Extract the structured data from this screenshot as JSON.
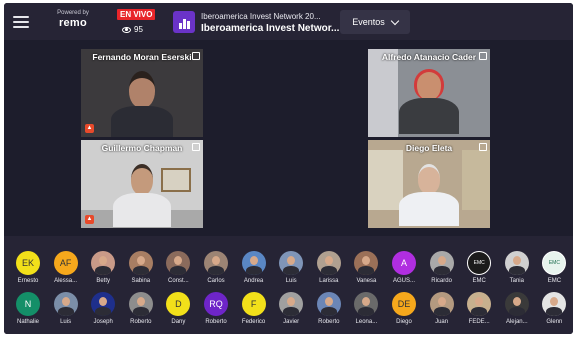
{
  "topbar": {
    "powered_by": "Powered by",
    "logo": "remo",
    "live": "EN VIVO",
    "viewers": "95",
    "event_title_1": "Iberoamerica Invest Network 20...",
    "event_title_2": "Iberoamerica Invest Networ...",
    "eventos": "Eventos"
  },
  "tiles": [
    {
      "name": "Fernando Moran Eserski"
    },
    {
      "name": "Alfredo Atanacio Cader"
    },
    {
      "name": "Guillermo Chapman"
    },
    {
      "name": "Diego Eleta"
    }
  ],
  "attendees_row1": [
    {
      "label": "Ernesto",
      "initials": "EK",
      "color": "#f2e01a"
    },
    {
      "label": "Alessa...",
      "initials": "AF",
      "color": "#f6a81c"
    },
    {
      "label": "Betty",
      "initials": "",
      "color": "#c99a88"
    },
    {
      "label": "Sabina",
      "initials": "",
      "color": "#a87e63"
    },
    {
      "label": "Const...",
      "initials": "",
      "color": "#8b6b5c"
    },
    {
      "label": "Carlos",
      "initials": "",
      "color": "#9c8474"
    },
    {
      "label": "Andrea",
      "initials": "",
      "color": "#5a87c4"
    },
    {
      "label": "Luis",
      "initials": "",
      "color": "#7f95b8"
    },
    {
      "label": "Larissa",
      "initials": "",
      "color": "#b0a090"
    },
    {
      "label": "Vanesa",
      "initials": "",
      "color": "#9b7058"
    },
    {
      "label": "AGUS...",
      "initials": "A",
      "color": "#b02ee0"
    },
    {
      "label": "Ricardo",
      "initials": "",
      "color": "#a9a9a9"
    },
    {
      "label": "EMC",
      "initials": "EMC",
      "color": "#1b1b1b"
    },
    {
      "label": "Tania",
      "initials": "",
      "color": "#d0d0d0"
    },
    {
      "label": "EMC",
      "initials": "EMC",
      "color": "#e8f4ee"
    }
  ],
  "attendees_row2": [
    {
      "label": "Nathalie",
      "initials": "N",
      "color": "#148f68"
    },
    {
      "label": "Luis",
      "initials": "",
      "color": "#7b8ea8"
    },
    {
      "label": "Joseph",
      "initials": "",
      "color": "#1e2f8c"
    },
    {
      "label": "Roberto",
      "initials": "",
      "color": "#8d8d8d"
    },
    {
      "label": "Dany",
      "initials": "D",
      "color": "#f2e01a"
    },
    {
      "label": "Roberto",
      "initials": "RQ",
      "color": "#6e25c8"
    },
    {
      "label": "Federico",
      "initials": "F",
      "color": "#f2e01a"
    },
    {
      "label": "Javier",
      "initials": "",
      "color": "#a0a0a0"
    },
    {
      "label": "Roberto",
      "initials": "",
      "color": "#6b86b6"
    },
    {
      "label": "Leona...",
      "initials": "",
      "color": "#6a6a6a"
    },
    {
      "label": "Diego",
      "initials": "DE",
      "color": "#f6a81c"
    },
    {
      "label": "Juan",
      "initials": "",
      "color": "#b49a80"
    },
    {
      "label": "FEDE...",
      "initials": "",
      "color": "#c7b08e"
    },
    {
      "label": "Alejan...",
      "initials": "",
      "color": "#3a3a3a"
    },
    {
      "label": "Glenn",
      "initials": "",
      "color": "#e4e4e4"
    }
  ]
}
